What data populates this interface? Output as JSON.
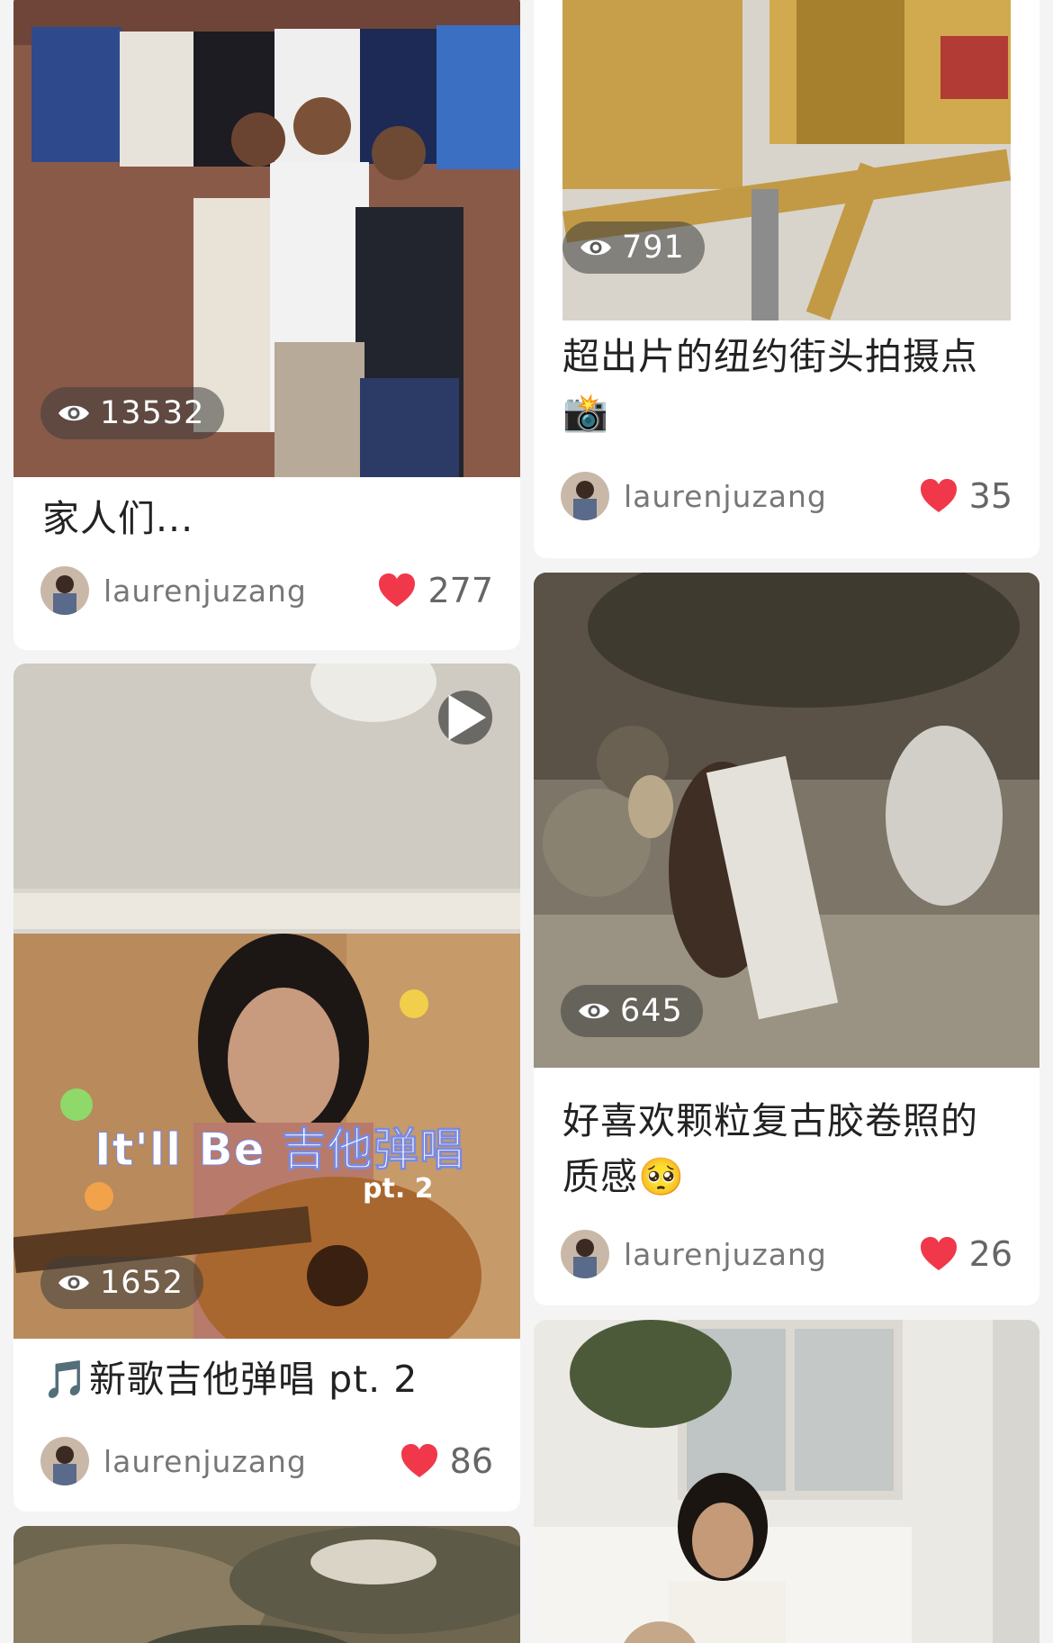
{
  "colors": {
    "heart": "#f0384a",
    "background": "#f4f4f4",
    "card": "#ffffff"
  },
  "posts": [
    {
      "id": "family",
      "views": "13532",
      "title": "家人们...",
      "author": "laurenjuzang",
      "likes": "277",
      "has_video": false
    },
    {
      "id": "guitar",
      "views": "1652",
      "title": "🎵新歌吉他弹唱 pt. 2",
      "author": "laurenjuzang",
      "likes": "86",
      "has_video": true,
      "overlay_text": "It'll Be 吉他弹唱",
      "overlay_sub": "pt. 2"
    },
    {
      "id": "nyc",
      "views": "791",
      "title": "超出片的纽约街头拍摄点📸",
      "author": "laurenjuzang",
      "likes": "35",
      "has_video": false
    },
    {
      "id": "film",
      "views": "645",
      "title": "好喜欢颗粒复古胶卷照的质感🥺",
      "author": "laurenjuzang",
      "likes": "26",
      "has_video": false
    },
    {
      "id": "landscape",
      "has_video": false
    },
    {
      "id": "sofa",
      "has_video": false
    }
  ],
  "icons": {
    "views": "eye-icon",
    "likes": "heart-icon",
    "play": "play-icon"
  }
}
